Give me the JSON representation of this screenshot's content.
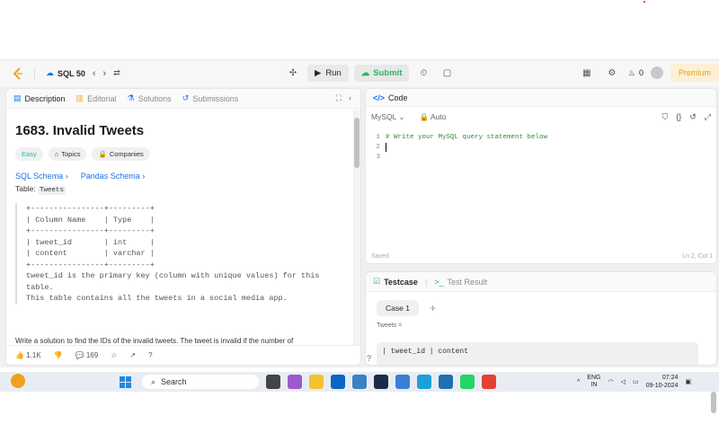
{
  "navbar": {
    "problem_list": "SQL 50",
    "run": "Run",
    "submit": "Submit",
    "streak": "0",
    "premium": "Premium"
  },
  "tabs": {
    "description": "Description",
    "editorial": "Editorial",
    "solutions": "Solutions",
    "submissions": "Submissions"
  },
  "problem": {
    "title": "1683. Invalid Tweets",
    "difficulty": "Easy",
    "topics": "Topics",
    "companies": "Companies",
    "sql_schema": "SQL Schema",
    "pandas_schema": "Pandas Schema",
    "table_prefix": "Table: ",
    "table_name": "Tweets",
    "schema_text": "+----------------+---------+\n| Column Name    | Type    |\n+----------------+---------+\n| tweet_id       | int     |\n| content        | varchar |\n+----------------+---------+\ntweet_id is the primary key (column with unique values) for this\ntable.\nThis table contains all the tweets in a social media app.",
    "description": "Write a solution to find the IDs of the invalid tweets. The tweet is invalid if the number of"
  },
  "footer": {
    "likes": "1.1K",
    "comments": "169"
  },
  "code": {
    "header": "Code",
    "language": "MySQL",
    "mode": "Auto",
    "lines": [
      "1",
      "2",
      "3"
    ],
    "line1": "# Write your MySQL query statement below",
    "status": "Saved",
    "position": "Ln 2, Col 1"
  },
  "testcase": {
    "tab": "Testcase",
    "result_tab": "Test Result",
    "case": "Case 1",
    "label": "Tweets =",
    "preview": "| tweet_id | content"
  },
  "taskbar": {
    "search": "Search",
    "lang": "ENG",
    "region": "IN",
    "time": "07:24",
    "date": "09-10-2024"
  }
}
